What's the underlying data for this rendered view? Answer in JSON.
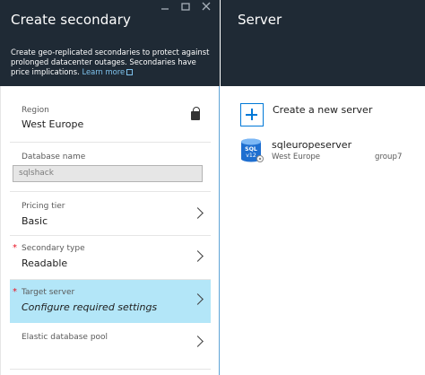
{
  "left_blade": {
    "title": "Create secondary",
    "description": "Create geo-replicated secondaries to protect against prolonged datacenter outages. Secondaries have price implications.",
    "learn_more": "Learn more",
    "fields": {
      "region": {
        "label": "Region",
        "value": "West Europe"
      },
      "database_name": {
        "label": "Database name",
        "value": "sqlshack"
      },
      "pricing_tier": {
        "label": "Pricing tier",
        "value": "Basic"
      },
      "secondary_type": {
        "label": "Secondary type",
        "value": "Readable",
        "required_mark": "*"
      },
      "target_server": {
        "label": "Target server",
        "value": "Configure required settings",
        "required_mark": "*"
      },
      "elastic_pool": {
        "label": "Elastic database pool"
      }
    }
  },
  "right_blade": {
    "title": "Server",
    "create_label": "Create a new server",
    "servers": [
      {
        "name": "sqleuropeserver",
        "region": "West Europe",
        "group": "group7",
        "icon_text_top": "SQL",
        "icon_text_bottom": "v12"
      }
    ]
  },
  "colors": {
    "header_bg": "#1f2a35",
    "accent": "#0078d7",
    "selected_bg": "#b3e6f8",
    "required": "#e81123"
  }
}
